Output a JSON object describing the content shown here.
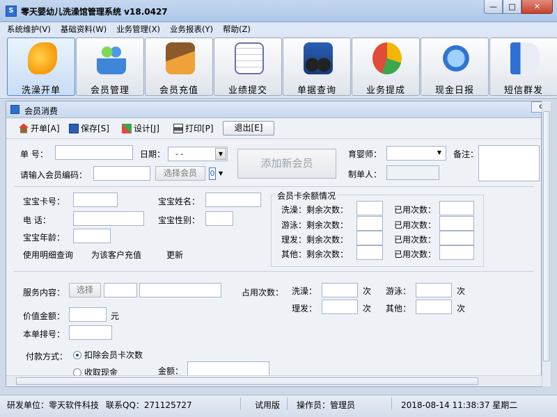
{
  "window": {
    "title": "零天婴幼儿洗澡馆管理系统   v18.0427",
    "icon": "app-icon"
  },
  "menu": [
    "系统维护(V)",
    "基础资料(W)",
    "业务管理(X)",
    "业务报表(Y)",
    "帮助(Z)"
  ],
  "toolbar": [
    {
      "label": "洗澡开单",
      "icon": "goldfish-icon"
    },
    {
      "label": "会员管理",
      "icon": "users-icon"
    },
    {
      "label": "会员充值",
      "icon": "card-wallet-icon"
    },
    {
      "label": "业绩提交",
      "icon": "calendar-pencil-icon"
    },
    {
      "label": "单据查询",
      "icon": "binoculars-icon"
    },
    {
      "label": "业务提成",
      "icon": "pie-chart-icon"
    },
    {
      "label": "现金日报",
      "icon": "refresh-globe-icon"
    },
    {
      "label": "短信群发",
      "icon": "megaphone-icon"
    }
  ],
  "child": {
    "title": "会员消费",
    "actions": {
      "open": "开单[A]",
      "save": "保存[S]",
      "design": "设计[J]",
      "print": "打印[P]",
      "exit": "退出[E]"
    },
    "header": {
      "order_no_label": "单    号：",
      "date_label": "日期：",
      "date_value": "  - -",
      "add_member": "添加新会员",
      "nurse_label": "育婴师：",
      "remark_label": "备注：",
      "member_code_label": "请输入会员编码：",
      "select_member": "选择会员",
      "spin_value": "0",
      "creator_label": "制单人："
    },
    "baby": {
      "card_label": "宝宝卡号：",
      "name_label": "宝宝姓名：",
      "phone_label": "电      话：",
      "gender_label": "宝宝性别：",
      "age_label": "宝宝年龄：",
      "detail_link": "使用明细查询",
      "recharge_link": "为该客户充值",
      "update_link": "更新"
    },
    "balance": {
      "title": "会员卡余额情况",
      "rows": [
        {
          "remain": "洗澡：剩余次数：",
          "used": "已用次数："
        },
        {
          "remain": "游泳：剩余次数：",
          "used": "已用次数："
        },
        {
          "remain": "理发：剩余次数：",
          "used": "已用次数："
        },
        {
          "remain": "其他：剩余次数：",
          "used": "已用次数："
        }
      ]
    },
    "service": {
      "content_label": "服务内容：",
      "select_btn": "选择",
      "occupy_label": "占用次数：",
      "bath_label": "洗澡：",
      "swim_label": "游泳：",
      "hair_label": "理发：",
      "other_label": "其他：",
      "times_unit": "次",
      "value_label": "价值金额：",
      "yuan": "元",
      "seq_label": "本单排号：",
      "pay_label": "付款方式：",
      "pay_option1": "扣除会员卡次数",
      "pay_option2": "收取现金",
      "amount_label": "金额："
    }
  },
  "status": {
    "developer": "研发单位：零天软件科技",
    "qq": "联系QQ：271125727",
    "edition": "试用版",
    "operator": "操作员：管理员",
    "datetime": "2018-08-14 11:38:37 星期二"
  },
  "colors": {
    "accent": "#2b6fd6",
    "titlebar": "#b9cfec",
    "close": "#c4432f"
  }
}
